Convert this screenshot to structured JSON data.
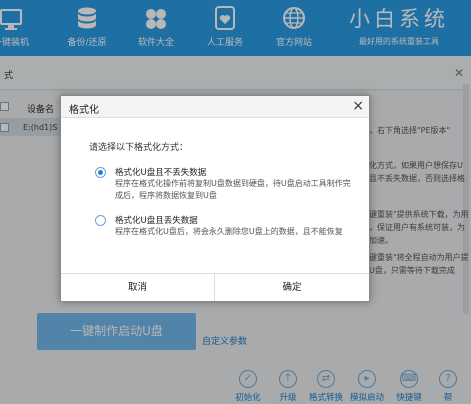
{
  "nav": {
    "items": [
      {
        "label": "一键装机",
        "icon": "monitor-icon"
      },
      {
        "label": "备份/还原",
        "icon": "database-icon"
      },
      {
        "label": "软件大全",
        "icon": "apps-icon"
      },
      {
        "label": "人工服务",
        "icon": "user-heart-icon"
      },
      {
        "label": "官方网站",
        "icon": "globe-icon"
      }
    ],
    "brand_title": "小白系统",
    "brand_subtitle": "最好用的系统重装工具"
  },
  "panel": {
    "breadcrumb": "式",
    "device_header": "设备名",
    "device_row": "E:(hd1)S",
    "right_texts": [
      "，右下角选择\"PE版本\"",
      "化方式，如果用户想保存U",
      "且不丢失数据，否则选择格",
      "键重装\"提供系统下载，为用",
      "，保证用户有系统可装，为",
      "加速。",
      "键重装\"将全程自动为用户提",
      "U盘，只需等待下载完成"
    ],
    "make_button": "一键制作启动U盘",
    "custom_params": "自定义参数",
    "tools": [
      "初始化",
      "升级",
      "格式转换",
      "模拟启动",
      "快捷键",
      "帮"
    ]
  },
  "dialog": {
    "title": "格式化",
    "close": "×",
    "prompt": "请选择以下格式化方式：",
    "options": [
      {
        "title": "格式化U盘且不丢失数据",
        "desc": "程序在格式化操作前将复制U盘数据到硬盘，待U盘启动工具制作完成后，程序将数据恢复到U盘",
        "selected": true
      },
      {
        "title": "格式化U盘且丢失数据",
        "desc": "程序在格式化U盘后，将会永久删除您U盘上的数据，且不能恢复",
        "selected": false
      }
    ],
    "cancel": "取消",
    "ok": "确定"
  },
  "colors": {
    "topbar": "#2a9be3",
    "accent": "#1e80d6"
  }
}
